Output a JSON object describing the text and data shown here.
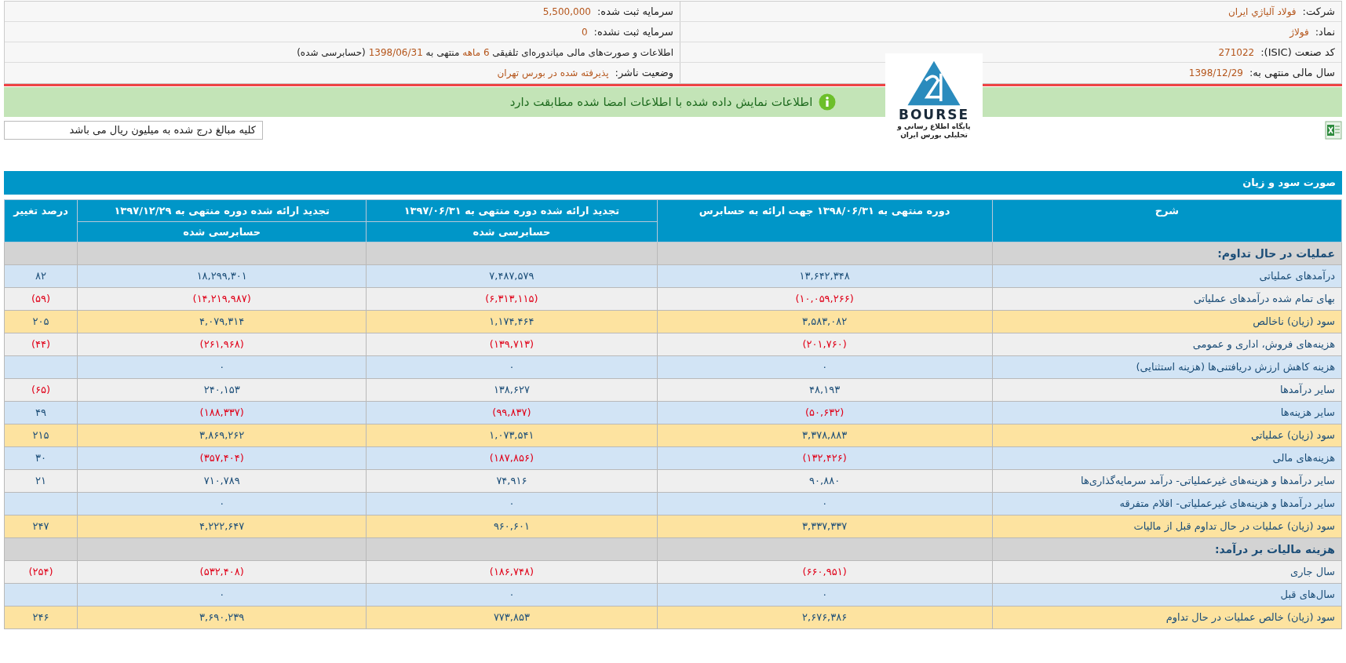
{
  "info_rows": [
    [
      {
        "label": "شرکت:",
        "value": [
          {
            "text": "فولاد آلیاژي ایران",
            "highlight": true
          }
        ]
      },
      {
        "label": "سرمایه ثبت شده:",
        "value": [
          {
            "text": "5,500,000",
            "highlight": true
          }
        ]
      }
    ],
    [
      {
        "label": "نماد:",
        "value": [
          {
            "text": "فولاژ",
            "highlight": true
          }
        ]
      },
      {
        "label": "سرمایه ثبت نشده:",
        "value": [
          {
            "text": "0",
            "highlight": true
          }
        ]
      }
    ],
    [
      {
        "label": "کد صنعت (ISIC):",
        "value": [
          {
            "text": "271022",
            "highlight": true
          }
        ]
      },
      {
        "value": [
          {
            "text": "اطلاعات و صورت‌های مالی میاندوره‌ای تلفیقی ",
            "highlight": false
          },
          {
            "text": "6 ماهه",
            "highlight": true
          },
          {
            "text": " منتهی به ",
            "highlight": false
          },
          {
            "text": "1398/06/31",
            "highlight": true
          },
          {
            "text": " (حسابرسی شده)",
            "highlight": false
          }
        ]
      }
    ],
    [
      {
        "label": "سال مالی منتهی به:",
        "value": [
          {
            "text": "1398/12/29",
            "highlight": true
          }
        ]
      },
      {
        "label": "وضعیت ناشر:",
        "value": [
          {
            "text": "پذیرفته شده در بورس تهران",
            "highlight": true
          }
        ]
      }
    ]
  ],
  "banner": {
    "kind": "success",
    "text": "اطلاعات نمایش داده شده با اطلاعات امضا شده مطابقت دارد"
  },
  "logo": {
    "mark": "BOURSE",
    "tagline": "پایگاه اطلاع رسانی و تحلیلی بورس ایران"
  },
  "note": "کلیه مبالغ درج شده به میلیون ریال می باشد",
  "table": {
    "title": "صورت سود و زیان",
    "columns": [
      {
        "title": "شرح"
      },
      {
        "title": "دوره منتهی به ۱۳۹۸/۰۶/۳۱ جهت ارائه به حسابرس"
      },
      {
        "title": "تجدید ارائه شده دوره منتهی به ۱۳۹۷/۰۶/۳۱",
        "subtitle": "حسابرسی شده"
      },
      {
        "title": "تجدید ارائه شده دوره منتهی به ۱۳۹۷/۱۲/۲۹",
        "subtitle": "حسابرسی شده"
      },
      {
        "title": "درصد تغییر"
      }
    ],
    "rows": [
      {
        "kind": "section",
        "cells": [
          {
            "text": "عملیات در حال تداوم:"
          }
        ]
      },
      {
        "kind": "blue",
        "cells": [
          {
            "text": "درآمدهای عملیاتی"
          },
          {
            "text": "۱۳,۶۴۲,۳۴۸",
            "negative": false
          },
          {
            "text": "۷,۴۸۷,۵۷۹",
            "negative": false
          },
          {
            "text": "۱۸,۲۹۹,۳۰۱",
            "negative": false
          },
          {
            "text": "۸۲",
            "negative": false
          }
        ]
      },
      {
        "kind": "grey",
        "cells": [
          {
            "text": "بهای تمام شده درآمدهای عملیاتی"
          },
          {
            "text": "(۱۰,۰۵۹,۲۶۶)",
            "negative": true
          },
          {
            "text": "(۶,۳۱۳,۱۱۵)",
            "negative": true
          },
          {
            "text": "(۱۴,۲۱۹,۹۸۷)",
            "negative": true
          },
          {
            "text": "(۵۹)",
            "negative": true
          }
        ]
      },
      {
        "kind": "yellow",
        "cells": [
          {
            "text": "سود (زیان) ناخالص"
          },
          {
            "text": "۳,۵۸۳,۰۸۲",
            "negative": false
          },
          {
            "text": "۱,۱۷۴,۴۶۴",
            "negative": false
          },
          {
            "text": "۴,۰۷۹,۳۱۴",
            "negative": false
          },
          {
            "text": "۲۰۵",
            "negative": false
          }
        ]
      },
      {
        "kind": "grey",
        "cells": [
          {
            "text": "هزینه‌های فروش، اداری و عمومی"
          },
          {
            "text": "(۲۰۱,۷۶۰)",
            "negative": true
          },
          {
            "text": "(۱۳۹,۷۱۳)",
            "negative": true
          },
          {
            "text": "(۲۶۱,۹۶۸)",
            "negative": true
          },
          {
            "text": "(۴۴)",
            "negative": true
          }
        ]
      },
      {
        "kind": "blue",
        "cells": [
          {
            "text": "هزینه کاهش ارزش دریافتنی‌ها (هزینه استثنایی)"
          },
          {
            "text": "۰",
            "negative": false
          },
          {
            "text": "۰",
            "negative": false
          },
          {
            "text": "۰",
            "negative": false
          },
          null
        ]
      },
      {
        "kind": "grey",
        "cells": [
          {
            "text": "سایر درآمدها"
          },
          {
            "text": "۴۸,۱۹۳",
            "negative": false
          },
          {
            "text": "۱۳۸,۶۲۷",
            "negative": false
          },
          {
            "text": "۲۴۰,۱۵۳",
            "negative": false
          },
          {
            "text": "(۶۵)",
            "negative": true
          }
        ]
      },
      {
        "kind": "blue",
        "cells": [
          {
            "text": "سایر هزینه‌ها"
          },
          {
            "text": "(۵۰,۶۳۲)",
            "negative": true
          },
          {
            "text": "(۹۹,۸۳۷)",
            "negative": true
          },
          {
            "text": "(۱۸۸,۳۳۷)",
            "negative": true
          },
          {
            "text": "۴۹",
            "negative": false
          }
        ]
      },
      {
        "kind": "yellow",
        "cells": [
          {
            "text": "سود (زیان) عملیاتي"
          },
          {
            "text": "۳,۳۷۸,۸۸۳",
            "negative": false
          },
          {
            "text": "۱,۰۷۳,۵۴۱",
            "negative": false
          },
          {
            "text": "۳,۸۶۹,۲۶۲",
            "negative": false
          },
          {
            "text": "۲۱۵",
            "negative": false
          }
        ]
      },
      {
        "kind": "blue",
        "cells": [
          {
            "text": "هزینه‌های مالی"
          },
          {
            "text": "(۱۳۲,۴۲۶)",
            "negative": true
          },
          {
            "text": "(۱۸۷,۸۵۶)",
            "negative": true
          },
          {
            "text": "(۳۵۷,۴۰۴)",
            "negative": true
          },
          {
            "text": "۳۰",
            "negative": false
          }
        ]
      },
      {
        "kind": "grey",
        "cells": [
          {
            "text": "سایر درآمدها و هزینه‌های غیرعملیاتی- درآمد سرمایه‌گذاری‌ها"
          },
          {
            "text": "۹۰,۸۸۰",
            "negative": false
          },
          {
            "text": "۷۴,۹۱۶",
            "negative": false
          },
          {
            "text": "۷۱۰,۷۸۹",
            "negative": false
          },
          {
            "text": "۲۱",
            "negative": false
          }
        ]
      },
      {
        "kind": "blue",
        "cells": [
          {
            "text": "سایر درآمدها و هزینه‌های غیرعملیاتی- اقلام متفرقه"
          },
          {
            "text": "۰",
            "negative": false
          },
          {
            "text": "۰",
            "negative": false
          },
          {
            "text": "۰",
            "negative": false
          },
          null
        ]
      },
      {
        "kind": "yellow",
        "cells": [
          {
            "text": "سود (زیان) عملیات در حال تداوم قبل از مالیات"
          },
          {
            "text": "۳,۳۳۷,۳۳۷",
            "negative": false
          },
          {
            "text": "۹۶۰,۶۰۱",
            "negative": false
          },
          {
            "text": "۴,۲۲۲,۶۴۷",
            "negative": false
          },
          {
            "text": "۲۴۷",
            "negative": false
          }
        ]
      },
      {
        "kind": "section",
        "cells": [
          {
            "text": "هزینه مالیات بر درآمد:"
          }
        ]
      },
      {
        "kind": "grey",
        "cells": [
          {
            "text": "سال جاری"
          },
          {
            "text": "(۶۶۰,۹۵۱)",
            "negative": true
          },
          {
            "text": "(۱۸۶,۷۴۸)",
            "negative": true
          },
          {
            "text": "(۵۳۲,۴۰۸)",
            "negative": true
          },
          {
            "text": "(۲۵۴)",
            "negative": true
          }
        ]
      },
      {
        "kind": "blue",
        "cells": [
          {
            "text": "سال‌های قبل"
          },
          {
            "text": "۰",
            "negative": false
          },
          {
            "text": "۰",
            "negative": false
          },
          {
            "text": "۰",
            "negative": false
          },
          null
        ]
      },
      {
        "kind": "yellow",
        "cells": [
          {
            "text": "سود (زیان) خالص عملیات در حال تداوم"
          },
          {
            "text": "۲,۶۷۶,۳۸۶",
            "negative": false
          },
          {
            "text": "۷۷۳,۸۵۳",
            "negative": false
          },
          {
            "text": "۳,۶۹۰,۲۳۹",
            "negative": false
          },
          {
            "text": "۲۴۶",
            "negative": false
          }
        ]
      }
    ]
  }
}
